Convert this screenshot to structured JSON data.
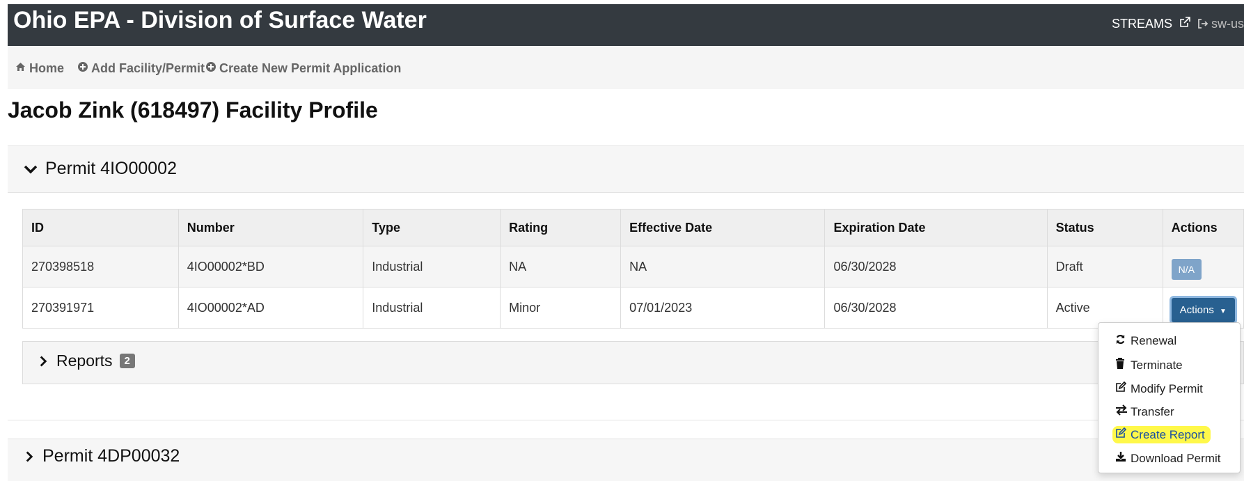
{
  "header": {
    "title": "Ohio EPA - Division of Surface Water",
    "streams_label": "STREAMS",
    "user_label": "sw-us"
  },
  "nav": {
    "home": "Home",
    "add_facility": "Add Facility/Permit",
    "create_application": "Create New Permit Application"
  },
  "page": {
    "title": "Jacob Zink (618497) Facility Profile"
  },
  "permit1": {
    "title": "Permit 4IO00002",
    "table": {
      "headers": [
        "ID",
        "Number",
        "Type",
        "Rating",
        "Effective Date",
        "Expiration Date",
        "Status",
        "Actions"
      ],
      "rows": [
        {
          "id": "270398518",
          "number": "4IO00002*BD",
          "type": "Industrial",
          "rating": "NA",
          "effective": "NA",
          "expiration": "06/30/2028",
          "status": "Draft",
          "action": "N/A"
        },
        {
          "id": "270391971",
          "number": "4IO00002*AD",
          "type": "Industrial",
          "rating": "Minor",
          "effective": "07/01/2023",
          "expiration": "06/30/2028",
          "status": "Active",
          "action": "Actions"
        }
      ]
    },
    "reports": {
      "label": "Reports",
      "count": "2"
    }
  },
  "permit2": {
    "title": "Permit 4DP00032"
  },
  "dropdown": {
    "items": [
      {
        "label": "Renewal",
        "icon": "refresh-icon"
      },
      {
        "label": "Terminate",
        "icon": "trash-icon"
      },
      {
        "label": "Modify Permit",
        "icon": "edit-icon"
      },
      {
        "label": "Transfer",
        "icon": "exchange-icon"
      },
      {
        "label": "Create Report",
        "icon": "edit-icon"
      },
      {
        "label": "Download Permit",
        "icon": "download-icon"
      }
    ],
    "highlight_color": "#fff84a"
  },
  "colors": {
    "header_bg": "#343a40",
    "actions_button": "#286090",
    "na_button": "#7fa4c9"
  }
}
